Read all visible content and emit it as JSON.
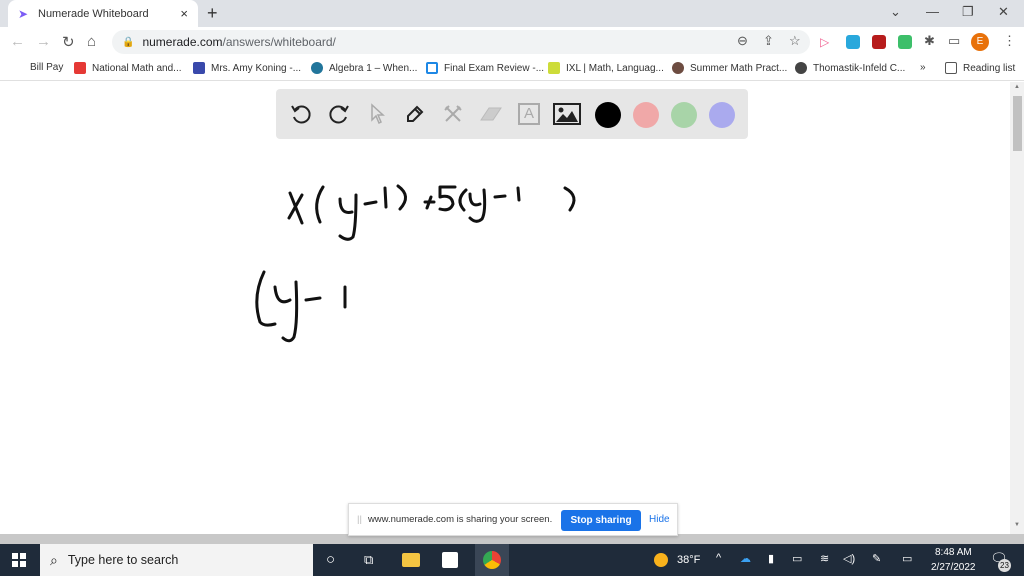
{
  "browser": {
    "tab_title": "Numerade Whiteboard",
    "tab_close": "×",
    "new_tab": "+",
    "window_controls": {
      "dropdown": "⌄",
      "minimize": "—",
      "restore": "❐",
      "close": "✕"
    },
    "url_host": "numerade.com",
    "url_path": "/answers/whiteboard/",
    "avatar_letter": "E",
    "bookmarks": [
      {
        "label": "Bill Pay",
        "icon": "none"
      },
      {
        "label": "National Math and...",
        "icon": "x-logo-icon",
        "color": "#e53935"
      },
      {
        "label": "Mrs. Amy Koning -...",
        "icon": "classroom-icon",
        "color": "#3949ab"
      },
      {
        "label": "Algebra 1 – When...",
        "icon": "wordpress-icon",
        "color": "#21759b"
      },
      {
        "label": "Final Exam Review -...",
        "icon": "sheet-icon",
        "color": "#1e88e5"
      },
      {
        "label": "IXL | Math, Languag...",
        "icon": "ixl-icon",
        "color": "#8bc34a"
      },
      {
        "label": "Summer Math Pract...",
        "icon": "record-icon",
        "color": "#6d4c41"
      },
      {
        "label": "Thomastik-Infeld C...",
        "icon": "globe-icon",
        "color": "#444"
      }
    ],
    "bookmarks_overflow": "»",
    "reading_list": "Reading list"
  },
  "whiteboard": {
    "tools": [
      "undo",
      "redo",
      "select",
      "pen",
      "tools",
      "eraser",
      "text",
      "image"
    ],
    "text_tool_glyph": "A",
    "colors": [
      "#000000",
      "#f0a8a8",
      "#a8d4a8",
      "#aaaaee"
    ],
    "handwriting": {
      "line1": "x(y-1) +5(y-1)",
      "line2": "(y-1"
    }
  },
  "share_bar": {
    "message": "www.numerade.com is sharing your screen.",
    "stop_label": "Stop sharing",
    "hide_label": "Hide"
  },
  "taskbar": {
    "search_placeholder": "Type here to search",
    "weather": "38°F",
    "time": "8:48 AM",
    "date": "2/27/2022",
    "notifications": "23"
  }
}
